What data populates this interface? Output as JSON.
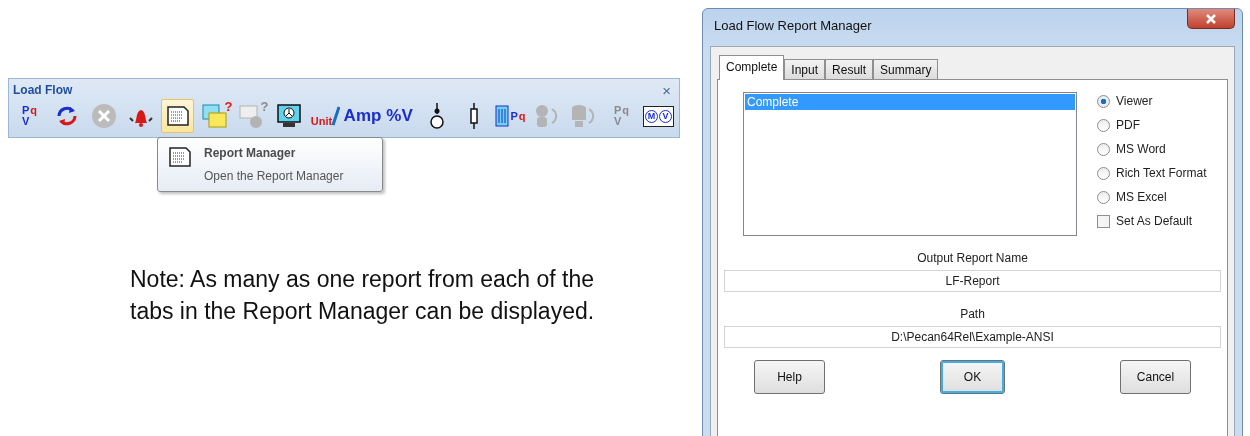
{
  "toolbar": {
    "title": "Load Flow",
    "close": "×",
    "items": [
      {
        "kind": "pqv",
        "letters": [
          "P",
          "q",
          "V"
        ],
        "disabled": false,
        "hovered": false
      },
      {
        "kind": "cycle",
        "disabled": false,
        "hovered": false
      },
      {
        "kind": "stop",
        "disabled": true,
        "hovered": false
      },
      {
        "kind": "alarm",
        "disabled": false,
        "hovered": false
      },
      {
        "kind": "report",
        "disabled": false,
        "hovered": true
      },
      {
        "kind": "report-query",
        "label": "?",
        "disabled": false,
        "hovered": false
      },
      {
        "kind": "report-person",
        "label": "?",
        "disabled": true,
        "hovered": false
      },
      {
        "kind": "monitor",
        "disabled": false,
        "hovered": false
      },
      {
        "kind": "unit",
        "label": "Unit",
        "disabled": false,
        "hovered": false
      },
      {
        "kind": "text",
        "label": "Amp",
        "disabled": false,
        "hovered": false
      },
      {
        "kind": "text",
        "label": "%V",
        "disabled": false,
        "hovered": false
      },
      {
        "kind": "bus",
        "disabled": false,
        "hovered": false
      },
      {
        "kind": "branch",
        "disabled": false,
        "hovered": false
      },
      {
        "kind": "grid",
        "letters": [
          "P",
          "q"
        ],
        "disabled": false,
        "hovered": false
      },
      {
        "kind": "person-cycle",
        "disabled": true,
        "hovered": false
      },
      {
        "kind": "drum-cycle",
        "disabled": true,
        "hovered": false
      },
      {
        "kind": "pqv",
        "letters": [
          "P",
          "q",
          "V"
        ],
        "disabled": true,
        "hovered": false
      },
      {
        "kind": "mv",
        "letters": [
          "M",
          "V"
        ],
        "disabled": false,
        "hovered": false
      }
    ]
  },
  "tooltip": {
    "title": "Report Manager",
    "description": "Open the Report Manager"
  },
  "note": "Note: As many as one report from each of the tabs in the Report Manager can be displayed.",
  "dialog": {
    "title": "Load Flow Report Manager",
    "tabs": [
      {
        "label": "Complete",
        "selected": true
      },
      {
        "label": "Input",
        "selected": false
      },
      {
        "label": "Result",
        "selected": false
      },
      {
        "label": "Summary",
        "selected": false
      }
    ],
    "reports": [
      {
        "label": "Complete",
        "selected": true
      }
    ],
    "formats": [
      {
        "label": "Viewer",
        "selected": true
      },
      {
        "label": "PDF",
        "selected": false
      },
      {
        "label": "MS Word",
        "selected": false
      },
      {
        "label": "Rich Text Format",
        "selected": false
      },
      {
        "label": "MS Excel",
        "selected": false
      }
    ],
    "set_default": {
      "label": "Set As Default",
      "checked": false
    },
    "output_name": {
      "label": "Output Report Name",
      "value": "LF-Report"
    },
    "path": {
      "label": "Path",
      "value": "D:\\Pecan64Rel\\Example-ANSI"
    },
    "buttons": [
      {
        "label": "Help",
        "default": false
      },
      {
        "label": "OK",
        "default": true
      },
      {
        "label": "Cancel",
        "default": false
      }
    ]
  }
}
